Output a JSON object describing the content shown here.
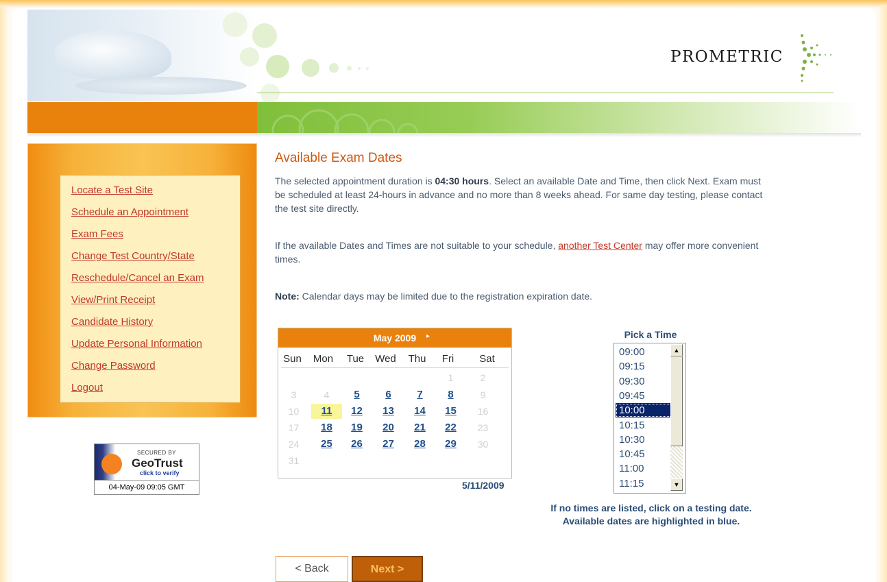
{
  "brand": {
    "logo_text": "PROMETRIC"
  },
  "sidebar": {
    "links": [
      "Locate a Test Site",
      "Schedule an Appointment",
      "Exam Fees",
      "Change Test Country/State",
      "Reschedule/Cancel an Exam",
      "View/Print Receipt",
      "Candidate History",
      "Update Personal Information",
      "Change Password",
      "Logout"
    ]
  },
  "geotrust": {
    "secured_by": "SECURED BY",
    "name": "GeoTrust",
    "verify": "click to verify",
    "timestamp": "04-May-09 09:05 GMT"
  },
  "main": {
    "title": "Available Exam Dates",
    "p1_a": "The selected appointment duration is ",
    "p1_duration": "04:30 hours",
    "p1_b": ". Select an available Date and Time, then click Next. Exam must be scheduled at least 24-hours in advance and no more than 8 weeks ahead. For same day testing, please contact the test site directly.",
    "p2_a": "If the available Dates and Times are not suitable to your schedule, ",
    "p2_link": "another Test Center",
    "p2_b": " may offer more convenient times.",
    "p3_label": "Note:",
    "p3_text": " Calendar days may be limited due to the registration expiration date."
  },
  "calendar": {
    "month_label": "May 2009",
    "next_arrow": "▸",
    "dow": [
      "Sun",
      "Mon",
      "Tue",
      "Wed",
      "Thu",
      "Fri",
      "Sat"
    ],
    "weeks": [
      [
        "",
        "",
        "",
        "",
        "",
        "1",
        "2"
      ],
      [
        "3",
        "4",
        "5",
        "6",
        "7",
        "8",
        "9"
      ],
      [
        "10",
        "11",
        "12",
        "13",
        "14",
        "15",
        "16"
      ],
      [
        "17",
        "18",
        "19",
        "20",
        "21",
        "22",
        "23"
      ],
      [
        "24",
        "25",
        "26",
        "27",
        "28",
        "29",
        "30"
      ],
      [
        "31",
        "",
        "",
        "",
        "",
        "",
        ""
      ]
    ],
    "available": [
      "5",
      "6",
      "7",
      "8",
      "11",
      "12",
      "13",
      "14",
      "15",
      "18",
      "19",
      "20",
      "21",
      "22",
      "25",
      "26",
      "27",
      "28",
      "29"
    ],
    "selected_day": "11",
    "selected_date": "5/11/2009"
  },
  "time_picker": {
    "label": "Pick a Time",
    "options": [
      "09:00",
      "09:15",
      "09:30",
      "09:45",
      "10:00",
      "10:15",
      "10:30",
      "10:45",
      "11:00",
      "11:15"
    ],
    "selected": "10:00"
  },
  "hints": {
    "line1": "If no times are listed, click on a testing date.",
    "line2": "Available dates are highlighted in blue."
  },
  "buttons": {
    "back": "< Back",
    "next": "Next >"
  }
}
